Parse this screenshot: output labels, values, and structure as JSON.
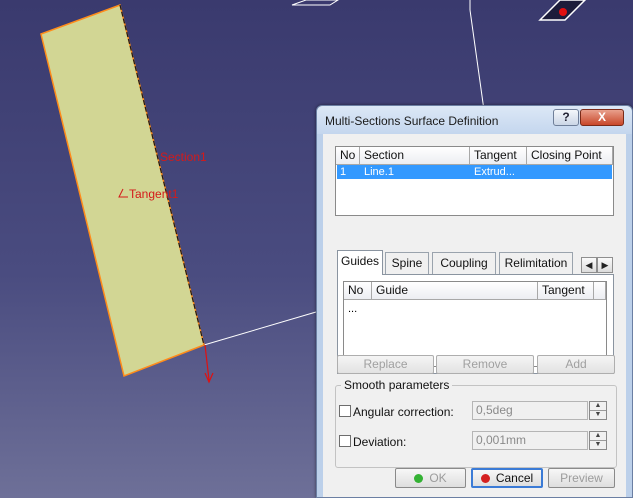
{
  "viewport": {
    "annotations": {
      "section": "Section1",
      "tangent": "Tangent1"
    },
    "colors": {
      "surface": "#d2d694",
      "edge": "#ff8c1a",
      "annotation": "#d41a1a"
    }
  },
  "dialog": {
    "title": "Multi-Sections Surface Definition",
    "title_buttons": {
      "help": "?",
      "close": "X"
    },
    "sections_table": {
      "columns": [
        "No",
        "Section",
        "Tangent",
        "Closing Point"
      ],
      "rows": [
        {
          "no": "1",
          "section": "Line.1",
          "tangent": "Extrud...",
          "closing_point": ""
        }
      ]
    },
    "tabs": [
      "Guides",
      "Spine",
      "Coupling",
      "Relimitation"
    ],
    "guides_table": {
      "columns": [
        "No",
        "Guide",
        "Tangent"
      ],
      "placeholder": "..."
    },
    "list_buttons": {
      "replace": "Replace",
      "remove": "Remove",
      "add": "Add"
    },
    "smooth": {
      "title": "Smooth parameters",
      "angular_label": "Angular correction:",
      "angular_value": "0,5deg",
      "deviation_label": "Deviation:",
      "deviation_value": "0,001mm"
    },
    "footer": {
      "ok": "OK",
      "cancel": "Cancel",
      "preview": "Preview"
    }
  }
}
